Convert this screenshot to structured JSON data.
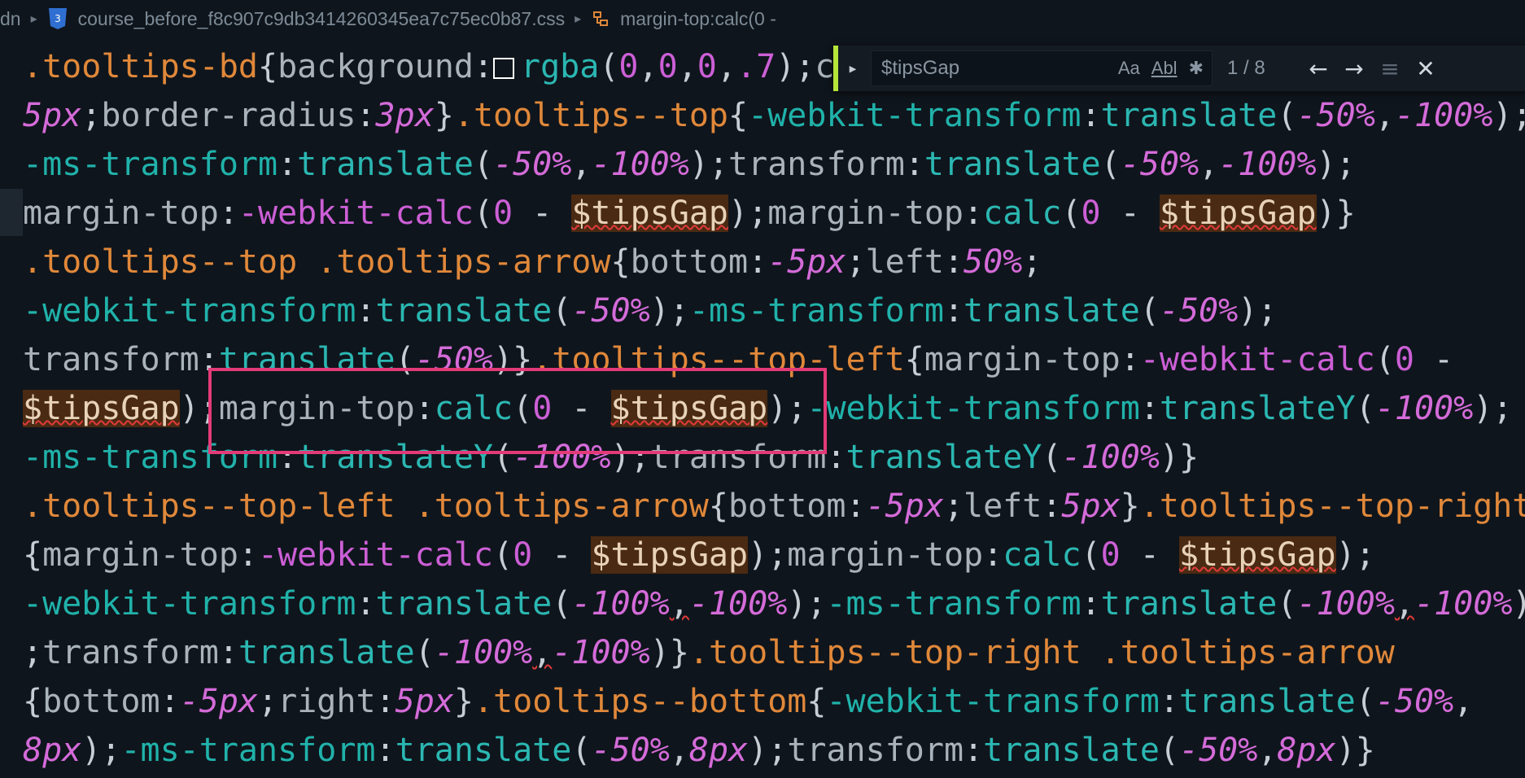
{
  "breadcrumb": {
    "root": "dn",
    "file": "course_before_f8c907c9db3414260345ea7c75ec0b87.css",
    "symbol": "margin-top:calc(0 -"
  },
  "find": {
    "query": "$tipsGap",
    "match_case_label": "Aa",
    "whole_word_label": "Abl",
    "count": "1 / 8"
  },
  "code": {
    "l1": [
      ".tooltips-bd",
      "{",
      "background",
      ":",
      "rgba",
      "(",
      "0",
      ",",
      "0",
      ",",
      "0",
      ",",
      ".7",
      ")",
      ";",
      "c"
    ],
    "l2": [
      "5px",
      ";",
      "border-radius",
      ":",
      "3px",
      "}",
      ".tooltips--top",
      "{",
      "-webkit-transform",
      ":",
      "translate",
      "(",
      "-50%",
      ",",
      "-100%",
      ")",
      ";"
    ],
    "l3": [
      "-ms-transform",
      ":",
      "translate",
      "(",
      "-50%",
      ",",
      "-100%",
      ")",
      ";",
      "transform",
      ":",
      "translate",
      "(",
      "-50%",
      ",",
      "-100%",
      ")",
      ";"
    ],
    "l4": [
      "margin-top",
      ":",
      "-webkit-calc",
      "(",
      "0",
      " - ",
      "$tipsGap",
      ")",
      ";",
      "margin-top",
      ":",
      "calc",
      "(",
      "0",
      " - ",
      "$tipsGap",
      ")",
      "}"
    ],
    "l5": [
      ".tooltips--top .tooltips-arrow",
      "{",
      "bottom",
      ":",
      "-5px",
      ";",
      "left",
      ":",
      "50%",
      ";"
    ],
    "l6": [
      "-webkit-transform",
      ":",
      "translate",
      "(",
      "-50%",
      ")",
      ";",
      "-ms-transform",
      ":",
      "translate",
      "(",
      "-50%",
      ")",
      ";"
    ],
    "l7": [
      "transform",
      ":",
      "translate",
      "(",
      "-50%",
      ")",
      "}",
      ".tooltips--top-left",
      "{",
      "margin-top",
      ":",
      "-webkit-calc",
      "(",
      "0",
      " -"
    ],
    "l8": [
      "$tipsGap",
      ")",
      ";",
      "margin-top",
      ":",
      "calc",
      "(",
      "0",
      " - ",
      "$tipsGap",
      ")",
      ";",
      "-webkit-transform",
      ":",
      "translateY",
      "(",
      "-100%",
      ")",
      ";"
    ],
    "l9": [
      "-ms-transform",
      ":",
      "translateY",
      "(",
      "-100%",
      ")",
      ";",
      "transform",
      ":",
      "translateY",
      "(",
      "-100%",
      ")",
      "}"
    ],
    "l10": [
      ".tooltips--top-left .tooltips-arrow",
      "{",
      "bottom",
      ":",
      "-5px",
      ";",
      "left",
      ":",
      "5px",
      "}",
      ".tooltips--top-right"
    ],
    "l11": [
      "{",
      "margin-top",
      ":",
      "-webkit-calc",
      "(",
      "0",
      " - ",
      "$tipsGap",
      ")",
      ";",
      "margin-top",
      ":",
      "calc",
      "(",
      "0",
      " - ",
      "$tipsGap",
      ")",
      ";"
    ],
    "l12": [
      "-webkit-transform",
      ":",
      "translate",
      "(",
      "-100%",
      ",",
      "-100%",
      ")",
      ";",
      "-ms-transform",
      ":",
      "translate",
      "(",
      "-100%",
      ",",
      "-100%",
      ")"
    ],
    "l13": [
      ";",
      "transform",
      ":",
      "translate",
      "(",
      "-100%",
      ",",
      "-100%",
      ")",
      "}",
      ".tooltips--top-right .tooltips-arrow"
    ],
    "l14": [
      "{",
      "bottom",
      ":",
      "-5px",
      ";",
      "right",
      ":",
      "5px",
      "}",
      ".tooltips--bottom",
      "{",
      "-webkit-transform",
      ":",
      "translate",
      "(",
      "-50%",
      ","
    ],
    "l15": [
      "8px",
      ")",
      ";",
      "-ms-transform",
      ":",
      "translate",
      "(",
      "-50%",
      ",",
      "8px",
      ")",
      ";",
      "transform",
      ":",
      "translate",
      "(",
      "-50%",
      ",",
      "8px",
      ")",
      "}"
    ]
  },
  "colors": {
    "background": "#0f151c",
    "selector": "#e0883a",
    "property": "#20b2aa",
    "value": "#cc5fd6",
    "match_highlight": "#4a2a12",
    "annotation_box": "#e33a78",
    "accent": "#b6e53a"
  }
}
